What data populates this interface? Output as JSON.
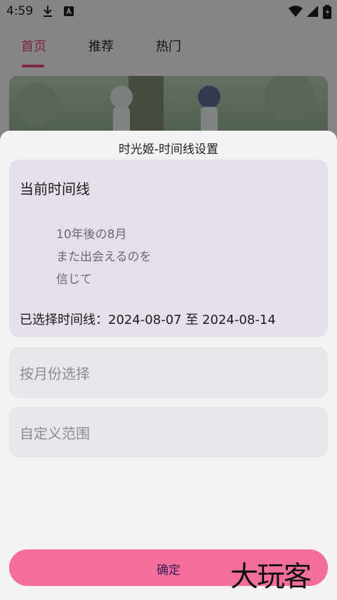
{
  "status_bar": {
    "time": "4:59",
    "icons": [
      "download-icon",
      "a-notification-icon",
      "wifi-icon",
      "signal-icon",
      "battery-icon"
    ]
  },
  "tabs": [
    {
      "label": "首页",
      "active": true
    },
    {
      "label": "推荐",
      "active": false
    },
    {
      "label": "热门",
      "active": false
    }
  ],
  "sheet": {
    "title": "时光姬-时间线设置",
    "current_card": {
      "heading": "当前时间线",
      "quote_lines": [
        "10年後の8月",
        "また出会えるのを",
        "信じて"
      ],
      "selected_range": "已选择时间线：2024-08-07 至 2024-08-14"
    },
    "options": [
      {
        "label": "按月份选择"
      },
      {
        "label": "自定义范围"
      }
    ],
    "confirm_label": "确定"
  },
  "watermark": "大玩客",
  "colors": {
    "accent": "#f36e99",
    "tab_active": "#e0457a",
    "card_current": "#e7deec",
    "card_option": "#e8e6ea"
  }
}
